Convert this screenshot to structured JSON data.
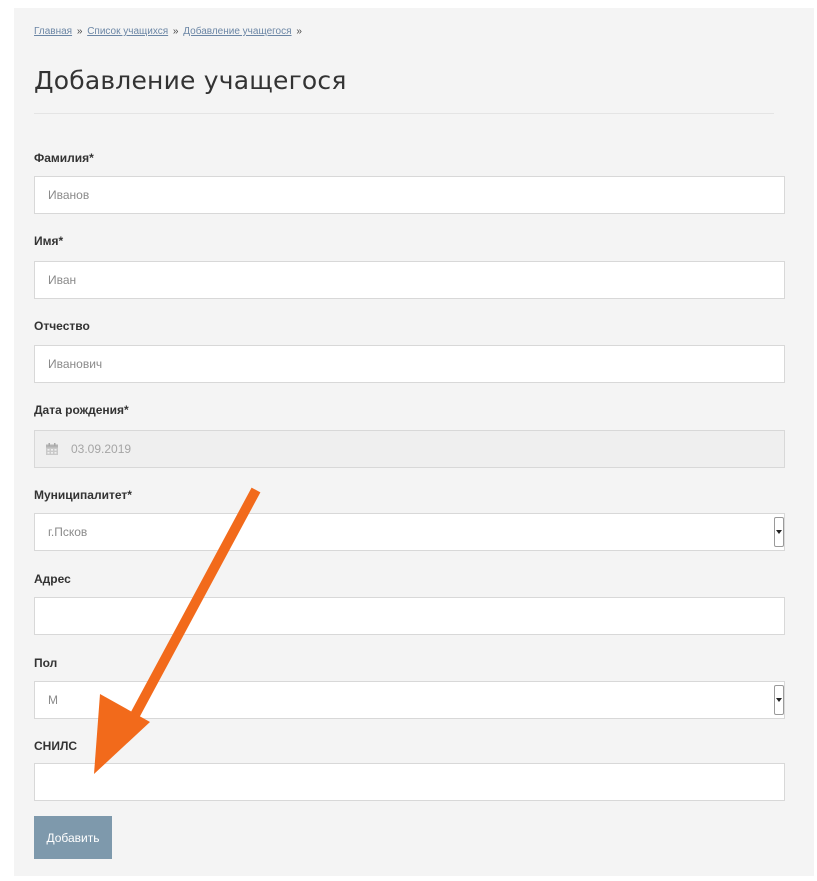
{
  "breadcrumb": {
    "items": [
      "Главная",
      "Список учащихся",
      "Добавление учащегося"
    ],
    "separator": "»"
  },
  "page_title": "Добавление учащегося",
  "form": {
    "last_name": {
      "label": "Фамилия*",
      "value": "Иванов"
    },
    "first_name": {
      "label": "Имя*",
      "value": "Иван"
    },
    "patronymic": {
      "label": "Отчество",
      "value": "Иванович"
    },
    "birth_date": {
      "label": "Дата рождения*",
      "value": "03.09.2019",
      "icon": "calendar-icon"
    },
    "municipality": {
      "label": "Муниципалитет*",
      "value": "г.Псков"
    },
    "address": {
      "label": "Адрес",
      "value": ""
    },
    "gender": {
      "label": "Пол",
      "value": "М"
    },
    "snils": {
      "label": "СНИЛС",
      "value": ""
    },
    "submit_label": "Добавить"
  },
  "colors": {
    "button_bg": "#7e99ac",
    "annotation_arrow": "#f26a1b",
    "page_bg": "#f4f4f4"
  }
}
